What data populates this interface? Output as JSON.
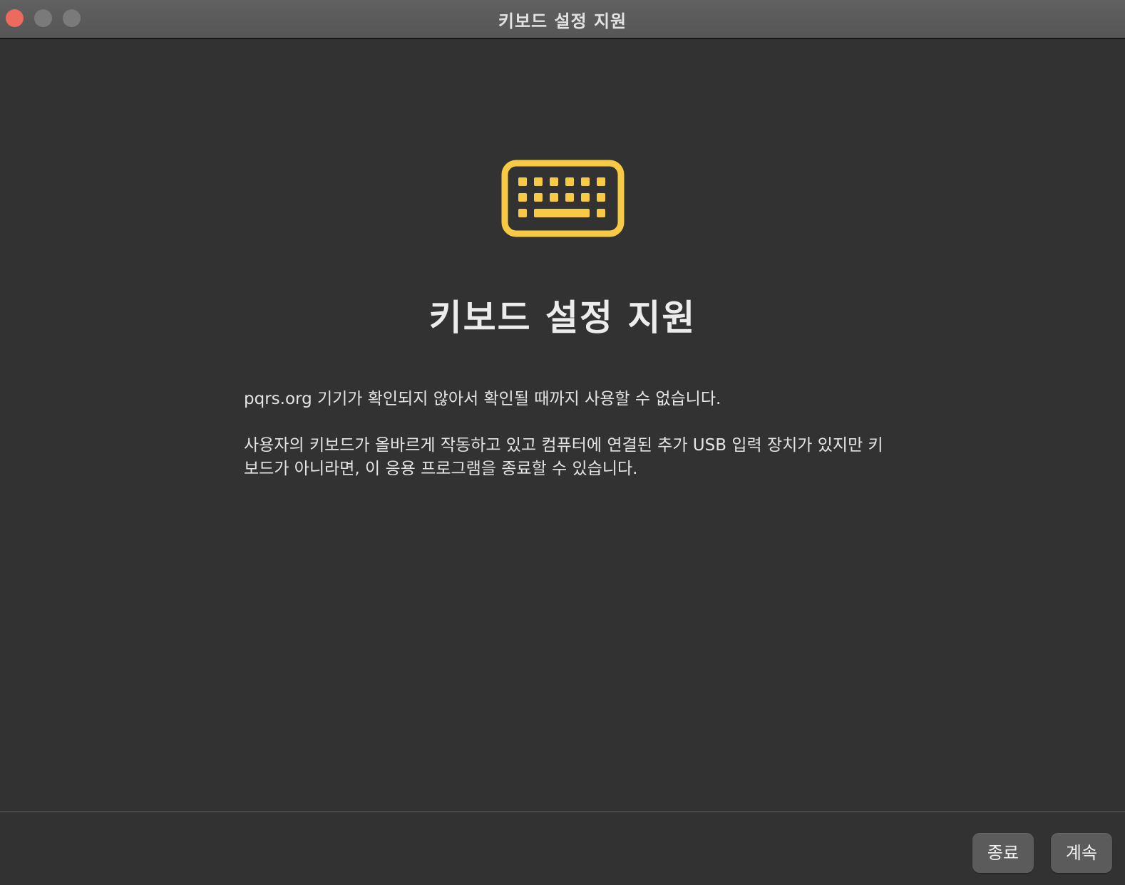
{
  "window": {
    "title": "키보드 설정 지원"
  },
  "icon": "keyboard-icon",
  "colors": {
    "accent_yellow": "#f7c945",
    "background": "#323232",
    "close_button": "#ed6a5e"
  },
  "main": {
    "heading": "키보드 설정 지원",
    "paragraph1": "pqrs.org 기기가 확인되지 않아서 확인될 때까지 사용할 수 없습니다.",
    "paragraph2": "사용자의 키보드가 올바르게 작동하고 있고 컴퓨터에 연결된 추가 USB 입력 장치가 있지만 키보드가 아니라면, 이 응용 프로그램을 종료할 수 있습니다."
  },
  "buttons": {
    "quit": "종료",
    "continue": "계속"
  }
}
